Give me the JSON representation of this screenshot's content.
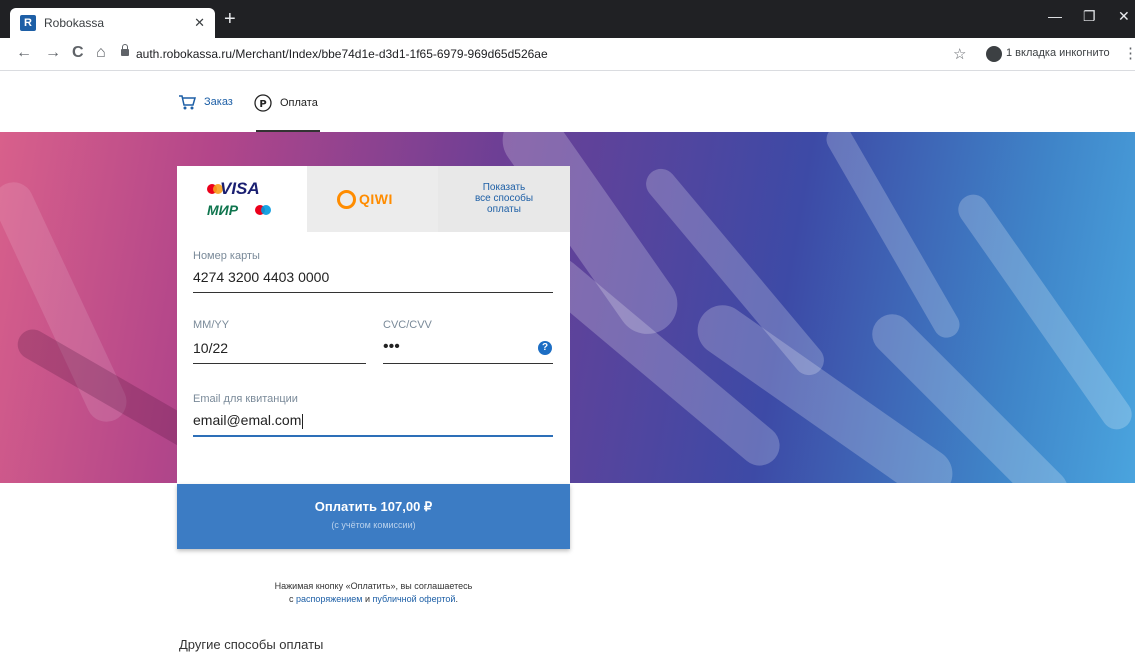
{
  "browser": {
    "tab_title": "Robokassa",
    "favicon_letter": "R",
    "url": "auth.robokassa.ru/Merchant/Index/bbe74d1e-d3d1-1f65-6979-969d65d526ae",
    "incognito_label": "1 вкладка инкогнито"
  },
  "steps": {
    "order_label": "Заказ",
    "payment_label": "Оплата"
  },
  "payment_tabs": {
    "cards": {
      "visa": "VISA",
      "mir": "МИР"
    },
    "qiwi": "QIWI",
    "all_methods": [
      "Показать",
      "все способы",
      "оплаты"
    ]
  },
  "form": {
    "card_number_label": "Номер карты",
    "card_number_value": "4274 3200 4403 0000",
    "expiry_label": "MM/YY",
    "expiry_value": "10/22",
    "cvc_label": "CVC/CVV",
    "cvc_value": "•••",
    "email_label": "Email для квитанции",
    "email_value": "email@emal.com"
  },
  "pay_button": {
    "label": "Оплатить 107,00 ₽",
    "sublabel": "(с учётом комиссии)"
  },
  "terms": {
    "line1": "Нажимая кнопку «Оплатить», вы соглашаетесь",
    "prefix": "с",
    "link1": "распоряжением",
    "and": "и",
    "link2": "публичной офертой",
    "suffix": "."
  },
  "other_methods_heading": "Другие способы оплаты",
  "colors": {
    "accent": "#3c7cc4",
    "link": "#1d5fa6",
    "qiwi": "#ff8c00"
  }
}
